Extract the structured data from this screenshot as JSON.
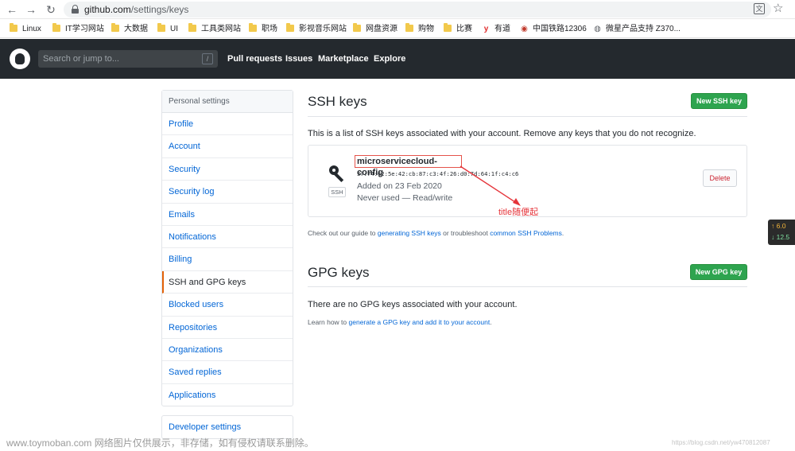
{
  "browser": {
    "back_icon": "←",
    "forward_icon": "→",
    "reload_icon": "↻",
    "url_host": "github.com",
    "url_path": "/settings/keys",
    "translate_icon": "文",
    "star_icon": "☆"
  },
  "bookmarks": [
    {
      "label": "Linux",
      "icon": "folder"
    },
    {
      "label": "IT学习网站",
      "icon": "folder"
    },
    {
      "label": "大数据",
      "icon": "folder"
    },
    {
      "label": "UI",
      "icon": "folder"
    },
    {
      "label": "工具类网站",
      "icon": "folder"
    },
    {
      "label": "职场",
      "icon": "folder"
    },
    {
      "label": "影视音乐网站",
      "icon": "folder"
    },
    {
      "label": "网盘资源",
      "icon": "folder"
    },
    {
      "label": "购物",
      "icon": "folder"
    },
    {
      "label": "比赛",
      "icon": "folder"
    },
    {
      "label": "有道",
      "icon": "y",
      "icon_glyph": "y",
      "icon_color": "#e02b2b"
    },
    {
      "label": "中国铁路12306",
      "icon": "railway",
      "icon_glyph": "◉",
      "icon_color": "#c0392b"
    },
    {
      "label": "微星产品支持 Z370...",
      "icon": "globe",
      "icon_glyph": "◍",
      "icon_color": "#5f6368"
    }
  ],
  "github": {
    "search_placeholder": "Search or jump to...",
    "search_key": "/",
    "nav": [
      "Pull requests",
      "Issues",
      "Marketplace",
      "Explore"
    ]
  },
  "sidebar": {
    "header": "Personal settings",
    "items": [
      {
        "label": "Profile",
        "active": false
      },
      {
        "label": "Account",
        "active": false
      },
      {
        "label": "Security",
        "active": false
      },
      {
        "label": "Security log",
        "active": false
      },
      {
        "label": "Emails",
        "active": false
      },
      {
        "label": "Notifications",
        "active": false
      },
      {
        "label": "Billing",
        "active": false
      },
      {
        "label": "SSH and GPG keys",
        "active": true
      },
      {
        "label": "Blocked users",
        "active": false
      },
      {
        "label": "Repositories",
        "active": false
      },
      {
        "label": "Organizations",
        "active": false
      },
      {
        "label": "Saved replies",
        "active": false
      },
      {
        "label": "Applications",
        "active": false
      }
    ],
    "developer": "Developer settings"
  },
  "ssh": {
    "title": "SSH keys",
    "new_button": "New SSH key",
    "description": "This is a list of SSH keys associated with your account. Remove any keys that you do not recognize.",
    "key": {
      "title": "microservicecloud-config",
      "fingerprint": "37:74:62:5e:42:cb:87:c3:4f:26:d0:7d:64:1f:c4:c6",
      "added": "Added on 23 Feb 2020",
      "used": "Never used — Read/write",
      "tag": "SSH",
      "delete_button": "Delete"
    },
    "guide_prefix": "Check out our guide to ",
    "guide_link1": "generating SSH keys",
    "guide_middle": " or troubleshoot ",
    "guide_link2": "common SSH Problems",
    "guide_suffix": "."
  },
  "gpg": {
    "title": "GPG keys",
    "new_button": "New GPG key",
    "empty": "There are no GPG keys associated with your account.",
    "learn_prefix": "Learn how to ",
    "learn_link": "generate a GPG key and add it to your account",
    "learn_suffix": "."
  },
  "annotation": {
    "text": "title随便起",
    "color": "#e5343a"
  },
  "speed_widget": {
    "up": "↑ 6.0",
    "down": "↓ 12.5"
  },
  "watermark": {
    "left": "www.toymoban.com 网络图片仅供展示，非存储，如有侵权请联系删除。",
    "right": "https://blog.csdn.net/yw470812087"
  },
  "colors": {
    "header_bg": "#24292e",
    "link": "#0366d6",
    "green_button": "#2ea44f",
    "active_marker": "#e36209",
    "danger": "#cb2431"
  }
}
